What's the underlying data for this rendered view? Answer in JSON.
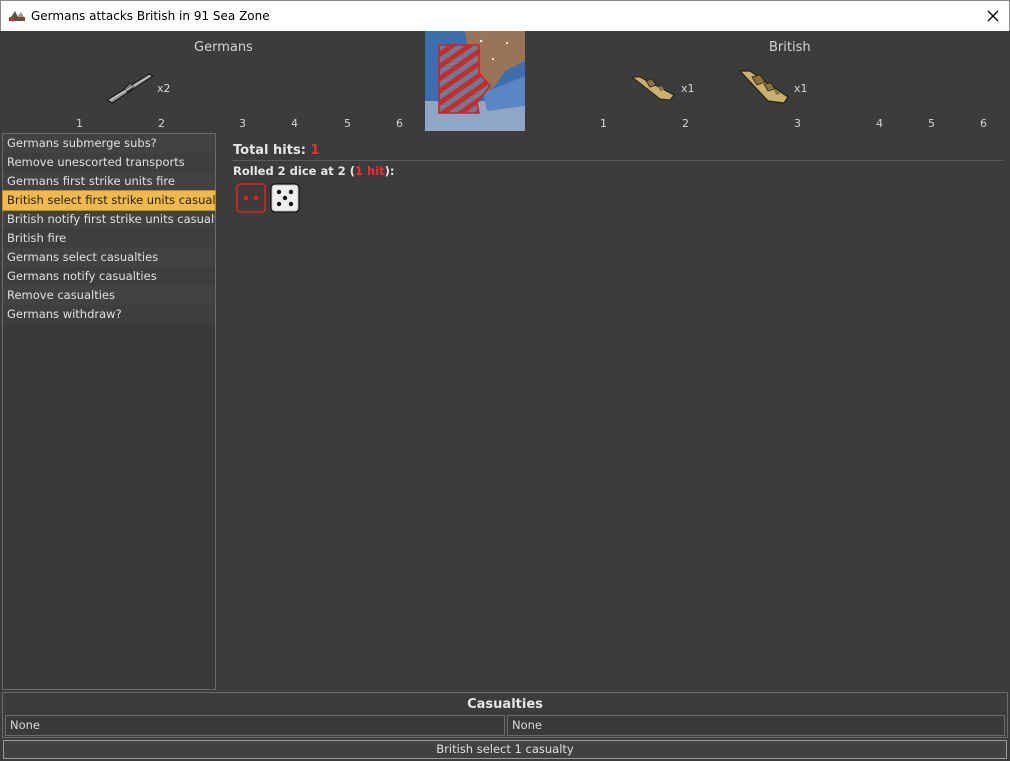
{
  "window": {
    "title": "Germans attacks British in 91 Sea Zone"
  },
  "header": {
    "attacker": {
      "name": "Germans",
      "units": [
        {
          "icon": "submarine-icon",
          "count": "x2"
        }
      ]
    },
    "defender": {
      "name": "British",
      "units": [
        {
          "icon": "destroyer-icon",
          "count": "x1"
        },
        {
          "icon": "battleship-icon",
          "count": "x1"
        }
      ]
    },
    "attacker_numbers": [
      "1",
      "2",
      "3",
      "4",
      "5",
      "6"
    ],
    "defender_numbers": [
      "1",
      "2",
      "3",
      "4",
      "5",
      "6"
    ]
  },
  "steps": [
    "Germans submerge subs?",
    "Remove unescorted transports",
    "Germans first strike units fire",
    "British select first strike units casualties",
    "British notify first strike units casualties",
    "British fire",
    "Germans select casualties",
    "Germans notify casualties",
    "Remove casualties",
    "Germans withdraw?"
  ],
  "active_step_index": 3,
  "results": {
    "total_label": "Total hits: ",
    "total_value": "1",
    "rolled_prefix": "Rolled 2 dice at 2 (",
    "rolled_hit": "1 hit",
    "rolled_suffix": "):",
    "dice": [
      {
        "value": 2,
        "hit": true
      },
      {
        "value": 5,
        "hit": false
      }
    ]
  },
  "casualties": {
    "title": "Casualties",
    "left": "None",
    "right": "None"
  },
  "status": {
    "text": "British select 1 casualty"
  },
  "colors": {
    "hit": "#ff2a2a",
    "active_step": "#f0b94c"
  }
}
